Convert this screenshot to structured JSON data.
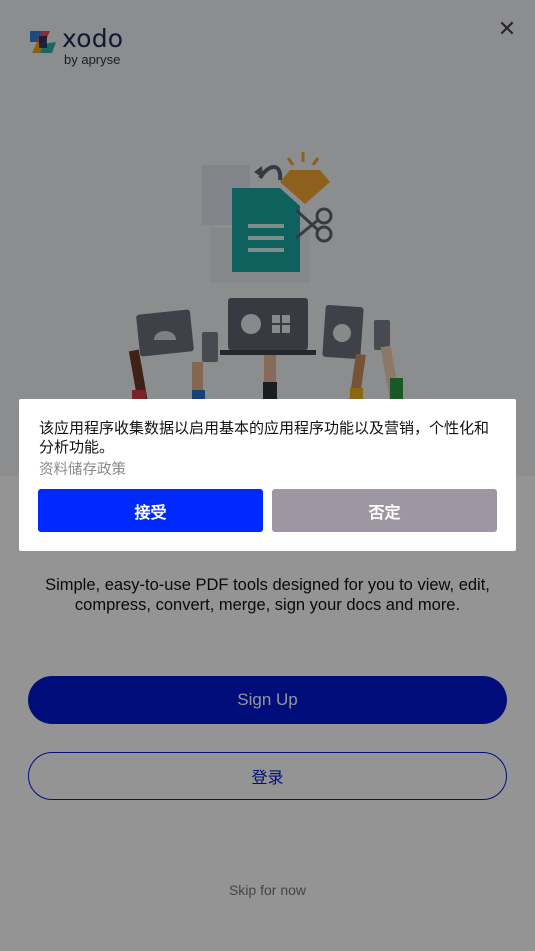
{
  "header": {
    "logo_word": "xodo",
    "logo_sub": "by apryse",
    "close_icon": "close-icon",
    "close_glyph": "✕"
  },
  "hero": {
    "illustration": "devices-document-illustration"
  },
  "main": {
    "description": "Simple, easy-to-use PDF tools designed for you to view, edit, compress, convert, merge, sign your docs and more.",
    "signup_label": "Sign Up",
    "login_label": "登录",
    "skip_label": "Skip for now"
  },
  "consent_dialog": {
    "message": "该应用程序收集数据以启用基本的应用程序功能以及营销，个性化和分析功能。",
    "policy_link": "资料储存政策",
    "accept_label": "接受",
    "deny_label": "否定"
  },
  "colors": {
    "primary": "#0018d4",
    "accept": "#0029ff",
    "deny": "#9e97a3",
    "overlay": "rgba(0,0,0,0.42)"
  }
}
